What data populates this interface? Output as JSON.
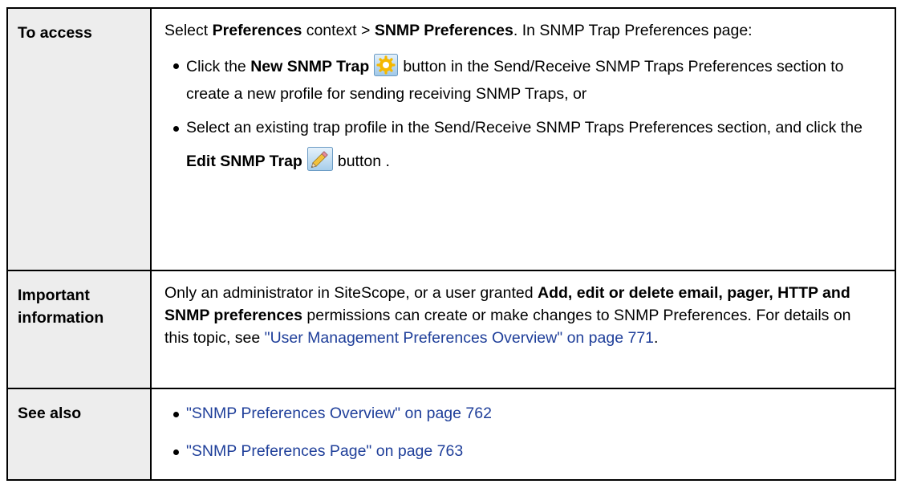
{
  "rows": {
    "access": {
      "label": "To access",
      "intro_1": "Select ",
      "intro_b1": "Preferences",
      "intro_2": " context > ",
      "intro_b2": "SNMP Preferences",
      "intro_3": ". In SNMP Trap Preferences page:",
      "bullet1": {
        "pre": "Click the ",
        "bold": "New SNMP Trap",
        "post": "button in the Send/Receive SNMP Traps Preferences section to create a new profile for sending receiving SNMP Traps, or"
      },
      "bullet2": {
        "pre": "Select an existing trap profile in the Send/Receive SNMP Traps Preferences section, and click the ",
        "bold": "Edit SNMP Trap",
        "post": "button ."
      },
      "icons": [
        "new-trap-icon",
        "edit-pencil-icon"
      ]
    },
    "important": {
      "label": "Important information",
      "text_1": "Only an administrator in SiteScope, or a user granted ",
      "bold": "Add, edit or delete email, pager, HTTP and SNMP preferences",
      "text_2": " permissions can create or make changes to SNMP Preferences. For details on this topic, see ",
      "link": "\"User Management Preferences Overview\" on page 771",
      "text_3": "."
    },
    "see_also": {
      "label": "See also",
      "links": [
        "\"SNMP Preferences Overview\" on page 762",
        "\"SNMP Preferences Page\" on page 763"
      ]
    }
  },
  "colors": {
    "label_bg": "#ededed",
    "link": "#1f3f9a",
    "border": "#000000"
  }
}
